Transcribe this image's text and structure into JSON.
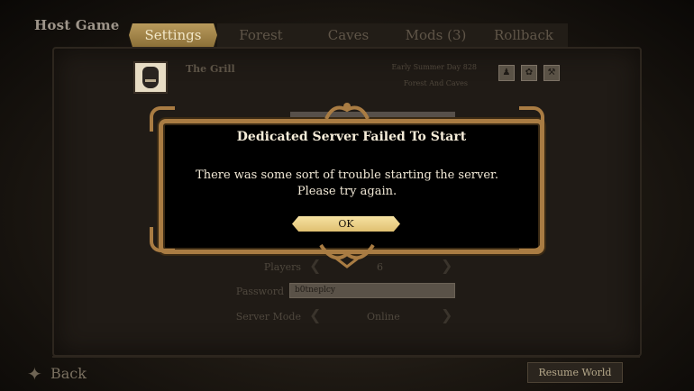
{
  "page": {
    "title": "Host Game"
  },
  "tabs": [
    {
      "label": "Settings",
      "active": true
    },
    {
      "label": "Forest",
      "active": false
    },
    {
      "label": "Caves",
      "active": false
    },
    {
      "label": "Mods (3)",
      "active": false
    },
    {
      "label": "Rollback",
      "active": false
    }
  ],
  "world": {
    "name": "The Grill",
    "day": "Early Summer Day 828",
    "type": "Forest And Caves",
    "icons": [
      "group-icon",
      "paw-icon",
      "tools-icon"
    ]
  },
  "settings": {
    "players_label": "Players",
    "players_value": "6",
    "password_label": "Password",
    "password_value": "b0tneplcy",
    "server_mode_label": "Server Mode",
    "server_mode_value": "Online"
  },
  "dialog": {
    "title": "Dedicated Server Failed To Start",
    "message": "There was some sort of trouble starting the server. Please try again.",
    "ok_label": "OK"
  },
  "footer": {
    "back_label": "Back",
    "resume_label": "Resume World"
  },
  "colors": {
    "accent": "#a97c43",
    "ok_button": "#f0d68d",
    "tab_active": "#a8884c"
  }
}
